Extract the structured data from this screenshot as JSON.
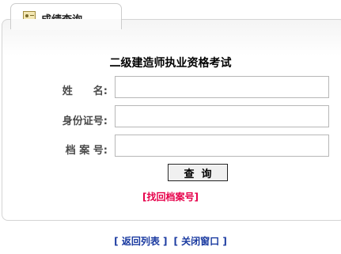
{
  "tab": {
    "icon": "id-card-icon",
    "title": "成绩查询"
  },
  "form": {
    "title": "二级建造师执业资格考试",
    "fields": [
      {
        "label": "姓　　名:",
        "value": ""
      },
      {
        "label": "身份证号:",
        "value": ""
      },
      {
        "label": "档 案 号:",
        "value": ""
      }
    ],
    "submit_label": "查询",
    "retrieve_link": "[找回档案号]"
  },
  "footer": {
    "back_link": "[ 返回列表 ]",
    "close_link": "[ 关闭窗口 ]"
  },
  "colors": {
    "link_red": "#e6004a",
    "link_blue": "#1a3aa0",
    "label_gray": "#4a4a4a"
  }
}
